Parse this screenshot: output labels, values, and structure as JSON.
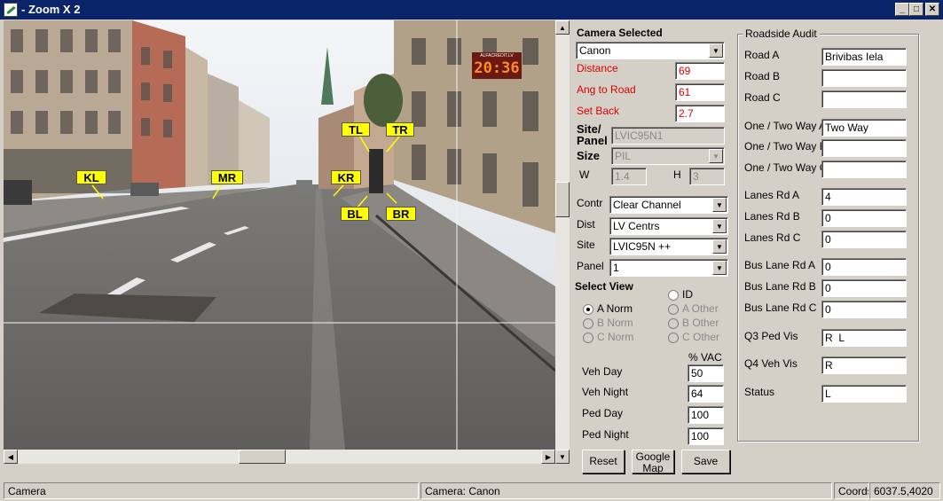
{
  "window": {
    "title": "- Zoom X 2",
    "icons": {
      "app": "app-icon",
      "minimize": "minimize-icon",
      "maximize": "maximize-icon",
      "close": "close-icon"
    },
    "minimize_glyph": "_",
    "maximize_glyph": "□",
    "close_glyph": "✕"
  },
  "photo": {
    "tags": {
      "KL": "KL",
      "MR": "MR",
      "TL": "TL",
      "TR": "TR",
      "KR": "KR",
      "BL": "BL",
      "BR": "BR"
    },
    "clock_text": "20:36",
    "sign_text": "ALFACREDIT.LV"
  },
  "camera": {
    "heading": "Camera Selected",
    "selected": "Canon",
    "distance_label": "Distance",
    "distance_value": "69",
    "ang_label": "Ang to Road",
    "ang_value": "61",
    "setback_label": "Set Back",
    "setback_value": "2.7",
    "site_panel_label_1": "Site/",
    "site_panel_label_2": "Panel",
    "site_panel_value": "LVIC95N1",
    "size_label": "Size",
    "size_value": "PIL",
    "w_label": "W",
    "w_value": "1.4",
    "h_label": "H",
    "h_value": "3",
    "contr_label": "Contr",
    "contr_value": "Clear Channel",
    "dist_label": "Dist",
    "dist_value": "LV Centrs",
    "site_label": "Site",
    "site_value": "LVIC95N ++",
    "panel_label": "Panel",
    "panel_value": "1"
  },
  "select_view": {
    "heading": "Select View",
    "options": {
      "id": "ID",
      "a_norm": "A Norm",
      "a_other": "A Other",
      "b_norm": "B Norm",
      "b_other": "B Other",
      "c_norm": "C Norm",
      "c_other": "C Other"
    },
    "selected": "A Norm"
  },
  "vac": {
    "header": "% VAC",
    "rows": [
      {
        "label": "Veh Day",
        "value": "50"
      },
      {
        "label": "Veh Night",
        "value": "64"
      },
      {
        "label": "Ped Day",
        "value": "100"
      },
      {
        "label": "Ped Night",
        "value": "100"
      }
    ]
  },
  "buttons": {
    "reset": "Reset",
    "google_1": "Google",
    "google_2": "Map",
    "save": "Save"
  },
  "audit": {
    "title": "Roadside Audit",
    "rows": [
      {
        "label": "Road A",
        "value": "Brivibas Iela"
      },
      {
        "label": "Road B",
        "value": ""
      },
      {
        "label": "Road C",
        "value": ""
      },
      {
        "label": "One / Two Way A",
        "value": "Two Way"
      },
      {
        "label": "One / Two Way B",
        "value": ""
      },
      {
        "label": "One / Two Way C",
        "value": ""
      },
      {
        "label": "Lanes Rd A",
        "value": "4"
      },
      {
        "label": "Lanes Rd B",
        "value": "0"
      },
      {
        "label": "Lanes Rd C",
        "value": "0"
      },
      {
        "label": "Bus Lane Rd A",
        "value": "0"
      },
      {
        "label": "Bus Lane Rd B",
        "value": "0"
      },
      {
        "label": "Bus Lane Rd C",
        "value": "0"
      },
      {
        "label": "Q3 Ped Vis",
        "value": "R  L"
      },
      {
        "label": "Q4 Veh Vis",
        "value": "R"
      },
      {
        "label": "Status",
        "value": "L"
      }
    ]
  },
  "statusbar": {
    "left": "Camera",
    "middle": "Camera: Canon",
    "coords_label": "Coords",
    "coords_value": "6037.5,4020"
  },
  "colors": {
    "titlebar": "#0a246a",
    "window_bg": "#d4d0c8",
    "marker_tag": "#ffff00",
    "red_label": "#e00000"
  }
}
